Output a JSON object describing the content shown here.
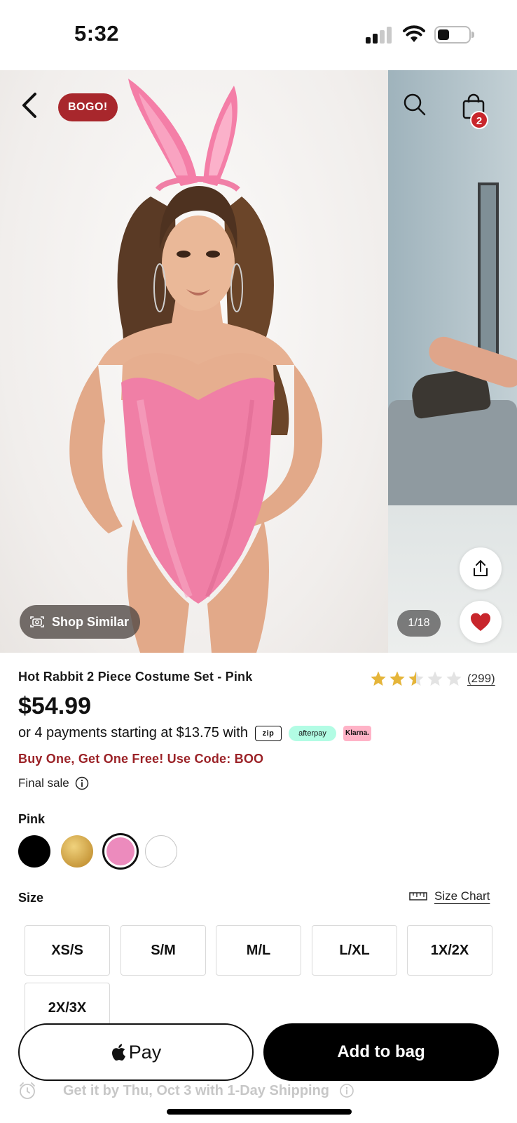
{
  "status_bar": {
    "time": "5:32"
  },
  "header": {
    "promo_badge": "BOGO!",
    "cart_count": "2",
    "icons": [
      "back-chevron-icon",
      "search-icon",
      "shopping-bag-icon"
    ]
  },
  "gallery": {
    "shop_similar_label": "Shop Similar",
    "counter": "1/18",
    "icons": [
      "camera-icon",
      "share-icon",
      "heart-icon"
    ]
  },
  "product": {
    "title": "Hot Rabbit 2 Piece Costume Set - Pink",
    "rating_value": 2.5,
    "rating_max": 5,
    "rating_count": "(299)",
    "price": "$54.99",
    "installments_text": "or 4 payments starting at $13.75 with",
    "payment_providers": {
      "zip": "zip",
      "afterpay": "afterpay",
      "klarna": "Klarna."
    },
    "promo_text": "Buy One, Get One Free! Use Code: BOO",
    "final_sale": "Final sale"
  },
  "colors": {
    "selected_label": "Pink",
    "options": [
      "black",
      "gold",
      "pink",
      "white"
    ],
    "selected": "pink"
  },
  "sizes": {
    "label": "Size",
    "size_chart_label": "Size Chart",
    "options": [
      "XS/S",
      "S/M",
      "M/L",
      "L/XL",
      "1X/2X",
      "2X/3X"
    ]
  },
  "actions": {
    "apple_pay_label": "Pay",
    "add_to_bag_label": "Add to bag",
    "shipping_text": "Get it by Thu, Oct 3 with 1-Day Shipping"
  },
  "theme": {
    "accent_red": "#a8272c",
    "star_gold": "#e5b53a",
    "button_black": "#000000"
  }
}
